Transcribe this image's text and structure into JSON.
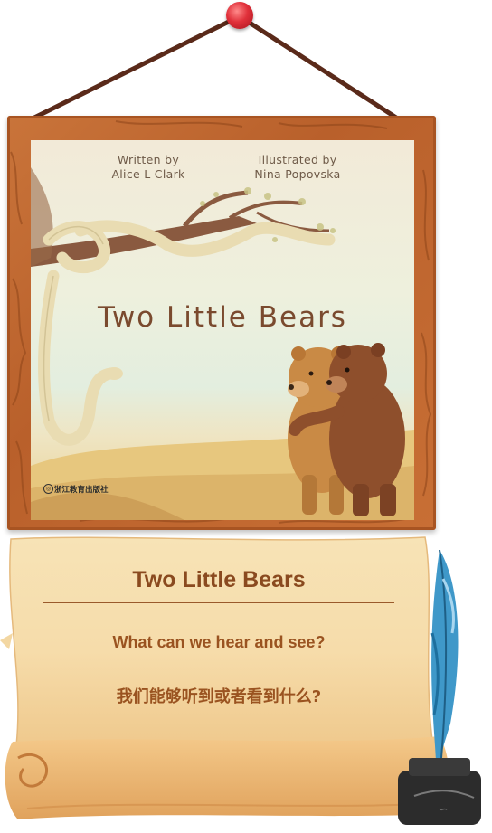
{
  "book": {
    "written_by_label": "Written by",
    "author": "Alice L Clark",
    "illustrated_by_label": "Illustrated by",
    "illustrator": "Nina Popovska",
    "cover_title": "Two Little Bears",
    "publisher": "浙江教育出版社"
  },
  "scroll": {
    "title": "Two Little Bears",
    "question_en": "What can we hear and see?",
    "question_cn": "我们能够听到或者看到什么?"
  },
  "icons": {
    "pin": "pushpin-icon",
    "quill": "quill-inkpot-icon"
  },
  "colors": {
    "frame_wood": "#b9602b",
    "parchment": "#f6dfae",
    "title_brown": "#8a4a1f",
    "pin_red": "#e0303a"
  }
}
